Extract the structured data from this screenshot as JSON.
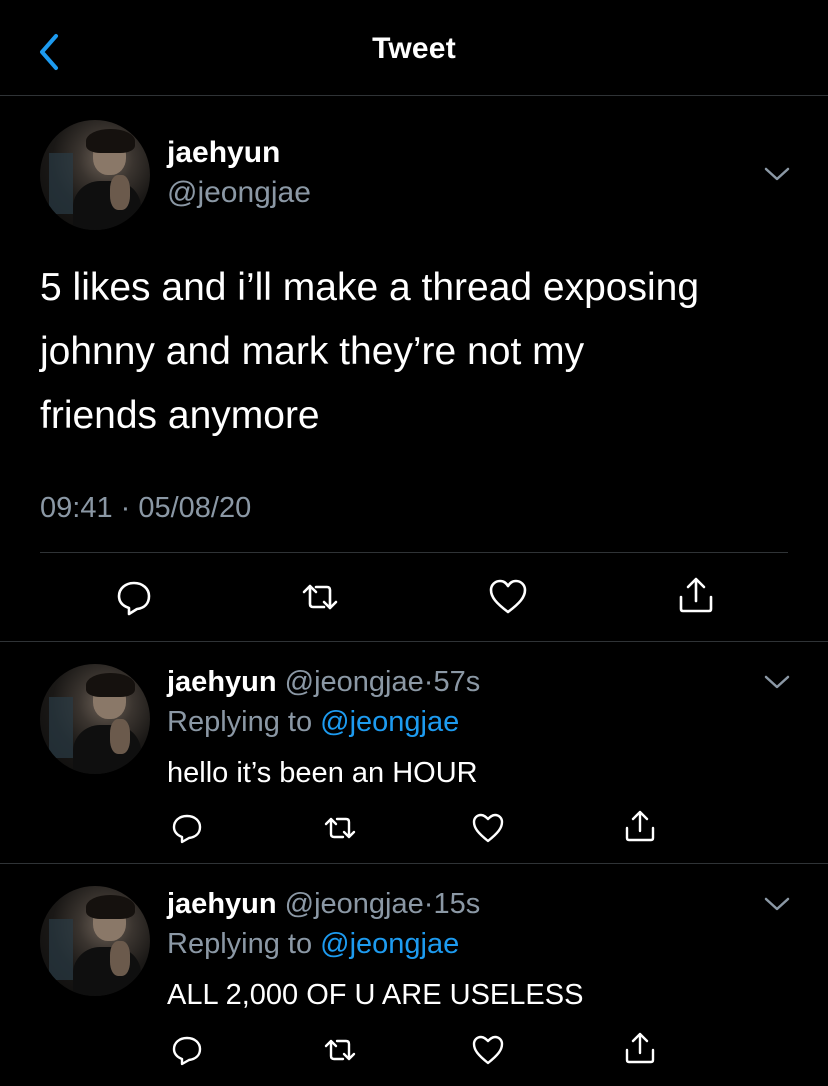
{
  "header": {
    "title": "Tweet"
  },
  "main_tweet": {
    "name": "jaehyun",
    "handle": "@jeongjae",
    "text_lines": [
      "5 likes and i’ll make a thread exposing",
      "johnny and mark they’re not my",
      "friends anymore"
    ],
    "timestamp": "09:41 · 05/08/20"
  },
  "replies": [
    {
      "name": "jaehyun",
      "handle": "@jeongjae",
      "separator": "·",
      "time": "57s",
      "replying_prefix": "Replying to",
      "replying_to": "@jeongjae",
      "text": "hello it’s been an HOUR"
    },
    {
      "name": "jaehyun",
      "handle": "@jeongjae",
      "separator": "·",
      "time": "15s",
      "replying_prefix": "Replying to",
      "replying_to": "@jeongjae",
      "text": "ALL 2,000 OF U ARE USELESS"
    }
  ],
  "icons": {
    "back": "chevron-left-icon",
    "more": "chevron-down-icon",
    "reply": "reply-bubble-icon",
    "retweet": "retweet-icon",
    "like": "heart-icon",
    "share": "share-icon"
  },
  "colors": {
    "background": "#000000",
    "text": "#ffffff",
    "secondary_text": "#8b98a5",
    "accent": "#1d9bf0",
    "divider": "#2f3336"
  }
}
